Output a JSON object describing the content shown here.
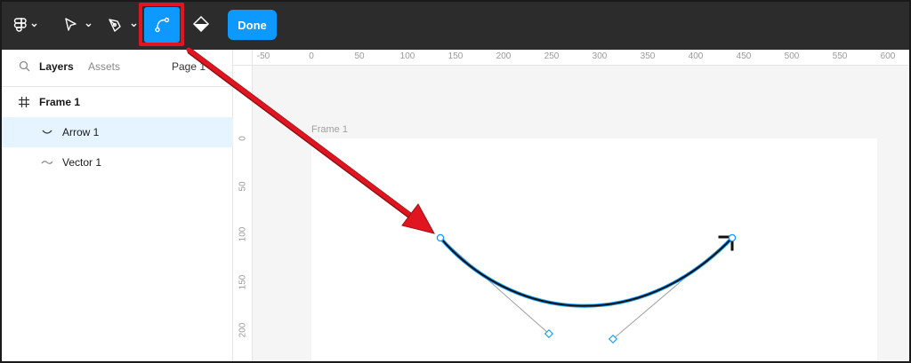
{
  "toolbar": {
    "main_menu_icon": "figma-logo-icon",
    "move_tool_icon": "pointer-arrow-icon",
    "pen_tool_icon": "pen-icon",
    "bend_tool_icon": "bend-curve-icon",
    "paint_bucket_icon": "paint-bucket-icon",
    "done_label": "Done",
    "accent": "#0d99ff",
    "highlight": "#e0151f"
  },
  "left_panel": {
    "tabs": {
      "layers": "Layers",
      "assets": "Assets"
    },
    "page": "Page 1",
    "layers": [
      {
        "name": "Frame 1",
        "icon": "frame-hash-icon",
        "selected": false,
        "bold": true
      },
      {
        "name": "Arrow 1",
        "icon": "curve-line-icon",
        "selected": true,
        "bold": false
      },
      {
        "name": "Vector 1",
        "icon": "vector-wave-icon",
        "selected": false,
        "bold": false
      }
    ]
  },
  "rulers": {
    "top": [
      "-50",
      "0",
      "50",
      "100",
      "150",
      "200",
      "250",
      "300",
      "350",
      "400",
      "450",
      "500",
      "550",
      "600"
    ],
    "left": [
      "0",
      "50",
      "100",
      "150",
      "200"
    ]
  },
  "canvas": {
    "frame_label": "Frame 1"
  }
}
